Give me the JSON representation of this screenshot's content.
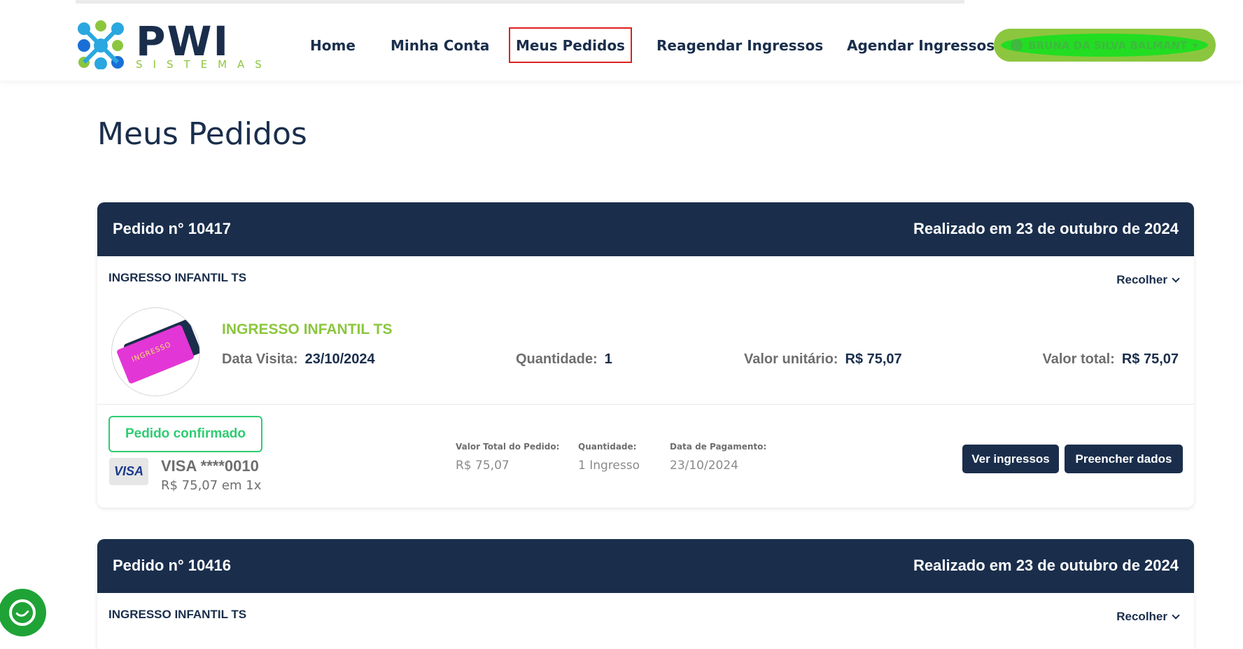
{
  "header": {
    "logo_main": "PWI",
    "logo_sub": "SISTEMAS",
    "nav": [
      "Home",
      "Minha Conta",
      "Meus Pedidos",
      "Reagendar Ingressos",
      "Agendar Ingressos"
    ],
    "user_name": "BRUNA DA SILVA BALMANT"
  },
  "page_title": "Meus Pedidos",
  "orders": [
    {
      "number": "Pedido n° 10417",
      "date": "Realizado em 23 de outubro de 2024",
      "item_name": "INGRESSO INFANTIL TS",
      "collapse_label": "Recolher",
      "product_title": "INGRESSO INFANTIL TS",
      "ticket_text": "INGRESSO",
      "data_visita_label": "Data Visita:",
      "data_visita": "23/10/2024",
      "quantidade_label": "Quantidade:",
      "quantidade": "1",
      "valor_unitario_label": "Valor unitário:",
      "valor_unitario": "R$ 75,07",
      "valor_total_label": "Valor total:",
      "valor_total": "R$ 75,07",
      "status": "Pedido confirmado",
      "card_brand": "VISA",
      "card_number": "VISA ****0010",
      "card_amount": "R$ 75,07 em 1x",
      "summary": {
        "total_label": "Valor Total do Pedido:",
        "total": "R$ 75,07",
        "qty_label": "Quantidade:",
        "qty": "1 Ingresso",
        "pay_label": "Data de Pagamento:",
        "pay_date": "23/10/2024"
      },
      "buttons": {
        "ver": "Ver ingressos",
        "preencher": "Preencher dados"
      }
    },
    {
      "number": "Pedido n° 10416",
      "date": "Realizado em 23 de outubro de 2024",
      "item_name": "INGRESSO INFANTIL TS",
      "collapse_label": "Recolher"
    }
  ],
  "colors": {
    "navy": "#1a2e4c",
    "brand_green": "#8cc63f",
    "confirm_green": "#2ecc71",
    "whatsapp": "#1fa336"
  }
}
